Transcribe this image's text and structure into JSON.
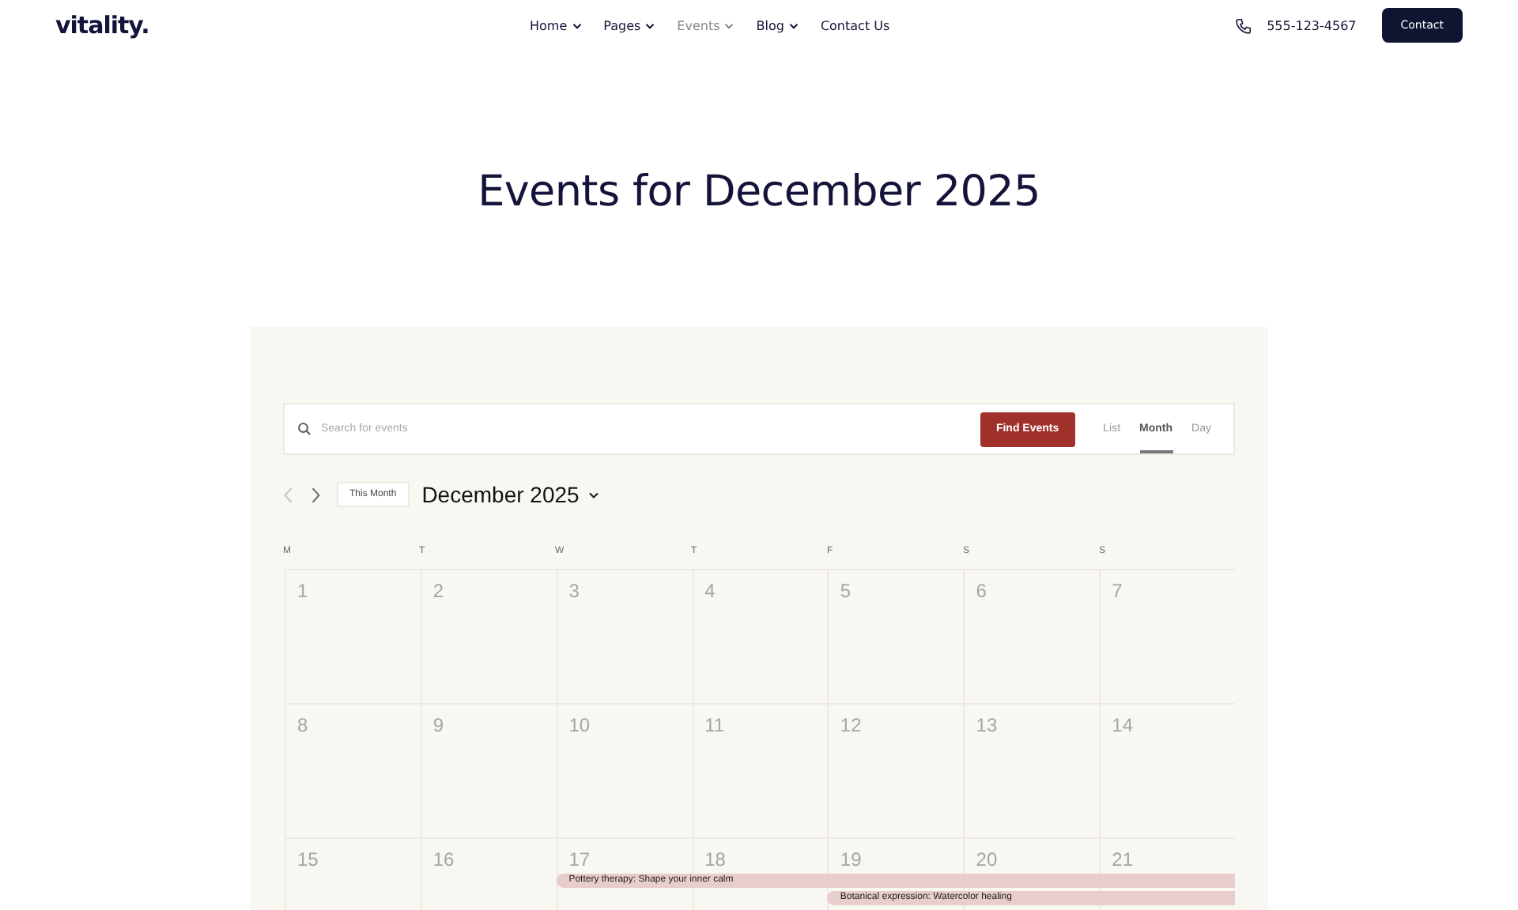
{
  "header": {
    "logo": "vitality.",
    "nav": [
      {
        "label": "Home",
        "dropdown": true,
        "selected": false
      },
      {
        "label": "Pages",
        "dropdown": true,
        "selected": false
      },
      {
        "label": "Events",
        "dropdown": true,
        "selected": true
      },
      {
        "label": "Blog",
        "dropdown": true,
        "selected": false
      },
      {
        "label": "Contact Us",
        "dropdown": false,
        "selected": false
      }
    ],
    "phone": "555-123-4567",
    "button": "Contact"
  },
  "page_title": "Events for December 2025",
  "search": {
    "placeholder": "Search for events",
    "button": "Find Events"
  },
  "views": [
    {
      "label": "List",
      "selected": false
    },
    {
      "label": "Month",
      "selected": true
    },
    {
      "label": "Day",
      "selected": false
    }
  ],
  "month_nav": {
    "today_button": "This Month",
    "month": "December 2025"
  },
  "weekdays": [
    "M",
    "T",
    "W",
    "T",
    "F",
    "S",
    "S"
  ],
  "weeks": [
    {
      "days": [
        {
          "day": "1"
        },
        {
          "day": "2"
        },
        {
          "day": "3"
        },
        {
          "day": "4"
        },
        {
          "day": "5"
        },
        {
          "day": "6"
        },
        {
          "day": "7"
        }
      ]
    },
    {
      "days": [
        {
          "day": "8"
        },
        {
          "day": "9"
        },
        {
          "day": "10"
        },
        {
          "day": "11"
        },
        {
          "day": "12"
        },
        {
          "day": "13"
        },
        {
          "day": "14"
        }
      ]
    },
    {
      "days": [
        {
          "day": "15"
        },
        {
          "day": "16"
        },
        {
          "day": "17",
          "events": [
            {
              "title": "Pottery therapy: Shape your inner calm"
            }
          ]
        },
        {
          "day": "18"
        },
        {
          "day": "19",
          "events": [
            {
              "title": "Botanical expression: Watercolor healing"
            }
          ]
        },
        {
          "day": "20"
        },
        {
          "day": "21"
        }
      ]
    }
  ]
}
